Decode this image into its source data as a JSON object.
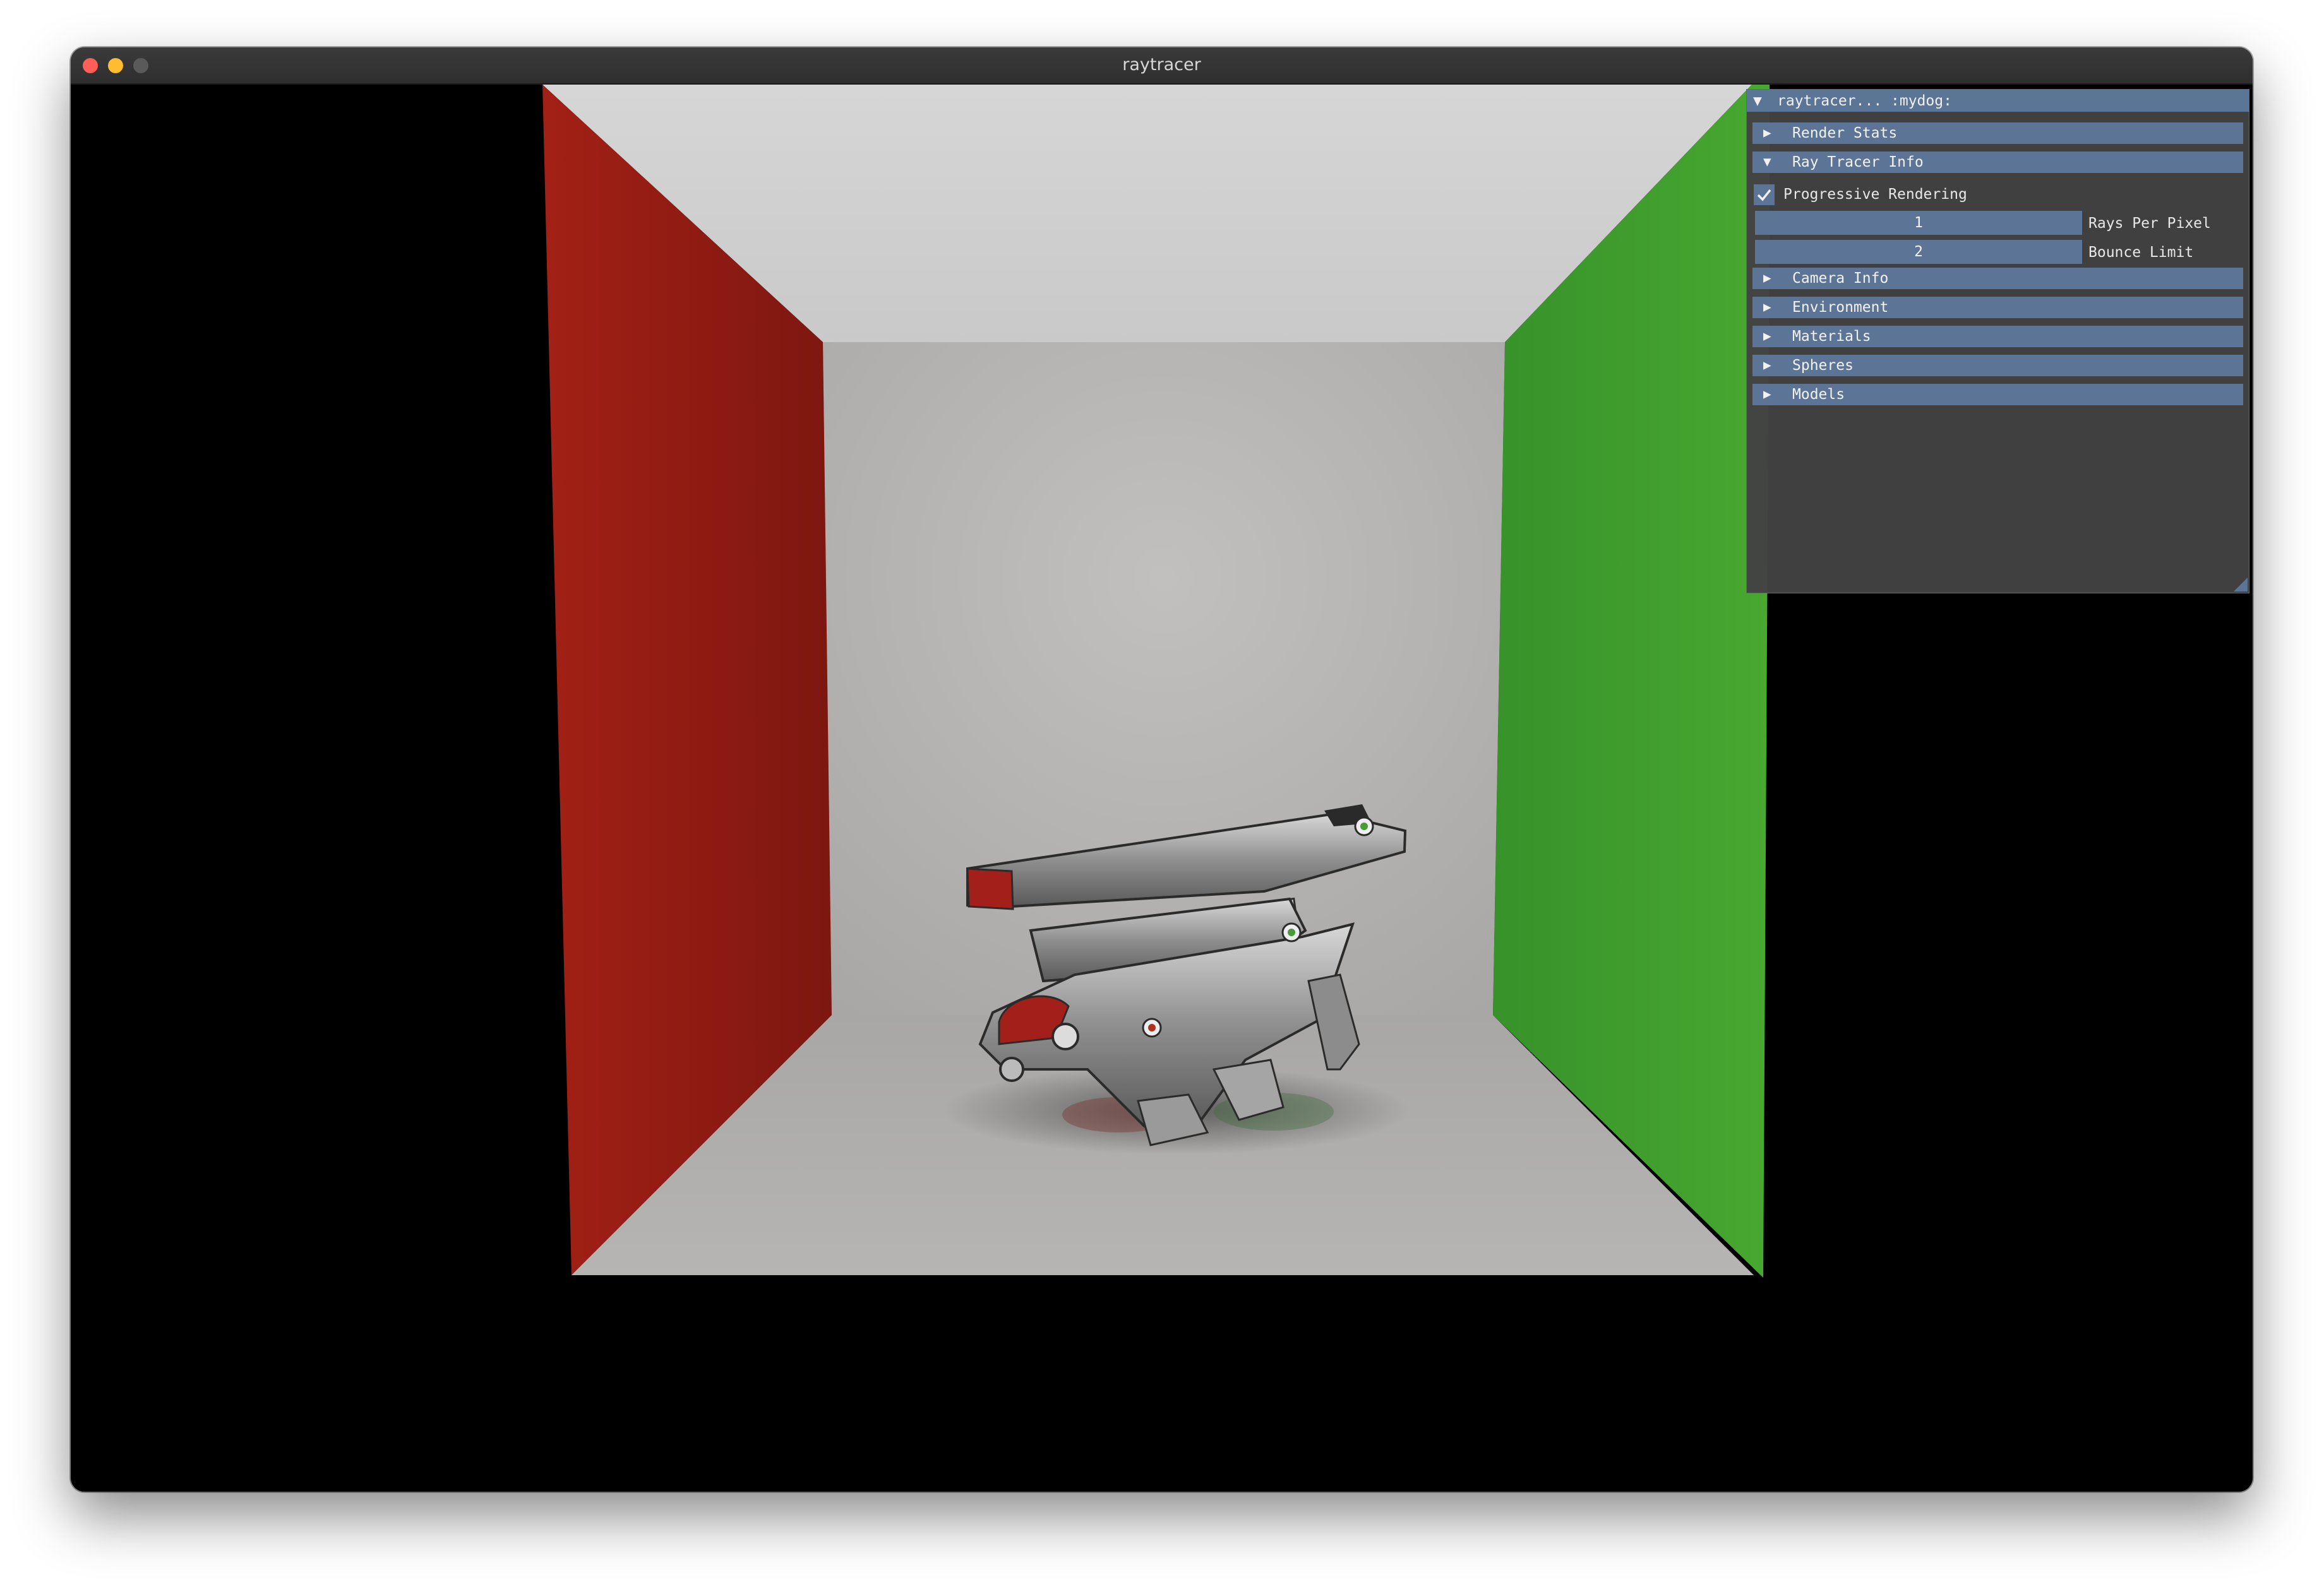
{
  "window": {
    "title": "raytracer"
  },
  "panel": {
    "title": "raytracer... :mydog:",
    "collapse_arrow": "▼",
    "sections": [
      {
        "label": "Render Stats",
        "expanded": false,
        "arrow": "▶"
      },
      {
        "label": "Ray Tracer Info",
        "expanded": true,
        "arrow": "▼"
      },
      {
        "label": "Camera Info",
        "expanded": false,
        "arrow": "▶"
      },
      {
        "label": "Environment",
        "expanded": false,
        "arrow": "▶"
      },
      {
        "label": "Materials",
        "expanded": false,
        "arrow": "▶"
      },
      {
        "label": "Spheres",
        "expanded": false,
        "arrow": "▶"
      },
      {
        "label": "Models",
        "expanded": false,
        "arrow": "▶"
      }
    ],
    "ray_tracer_info": {
      "progressive_rendering_label": "Progressive Rendering",
      "progressive_rendering_checked": true,
      "rays_per_pixel_value": "1",
      "rays_per_pixel_label": "Rays Per Pixel",
      "bounce_limit_value": "2",
      "bounce_limit_label": "Bounce Limit"
    }
  },
  "colors": {
    "left_wall": "#8c1c12",
    "right_wall": "#3c9a2a",
    "ceiling": "#d0d0d0",
    "back_wall": "#b4b2b0",
    "floor": "#aaa9a7",
    "panel_accent": "#5c7596"
  }
}
